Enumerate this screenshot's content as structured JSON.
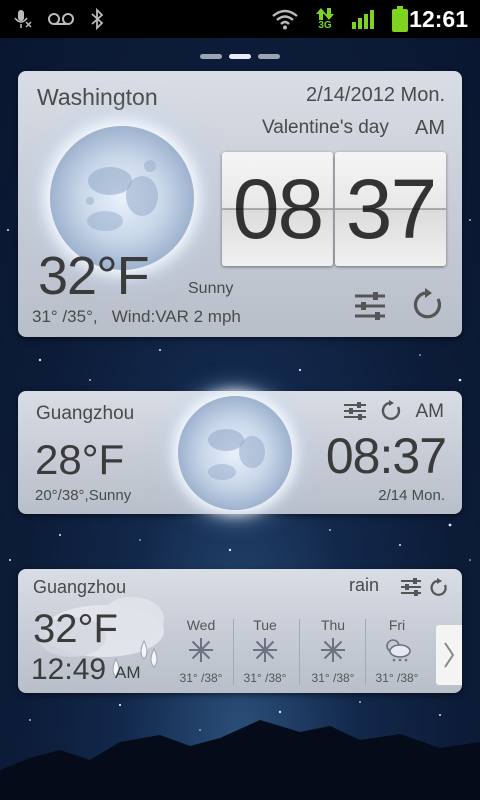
{
  "status_bar": {
    "time": "12:61",
    "network": "3G",
    "icons": [
      "mic-muted-icon",
      "voicemail-icon",
      "bluetooth-icon",
      "wifi-icon",
      "data-arrows-icon",
      "signal-icon",
      "battery-icon"
    ]
  },
  "pager": {
    "pages": 3,
    "active": 2
  },
  "widget_large": {
    "city": "Washington",
    "date": "2/14/2012 Mon.",
    "holiday": "Valentine's day",
    "ampm": "AM",
    "hour": "08",
    "minute": "37",
    "temp": "32°F",
    "condition": "Sunny",
    "range_wind": "31° /35°,   Wind:VAR 2 mph"
  },
  "widget_medium": {
    "city": "Guangzhou",
    "ampm": "AM",
    "temp": "28°F",
    "time": "08:37",
    "range_condition": "20°/38°,Sunny",
    "date": "2/14 Mon."
  },
  "widget_forecast": {
    "city": "Guangzhou",
    "condition": "rain",
    "temp": "32°F",
    "time": "12:49",
    "ampm": "AM",
    "days": [
      {
        "day": "Wed",
        "icon": "snowflake-icon",
        "temp": "31° /38°"
      },
      {
        "day": "Tue",
        "icon": "snowflake-icon",
        "temp": "31° /38°"
      },
      {
        "day": "Thu",
        "icon": "snowflake-icon",
        "temp": "31° /38°"
      },
      {
        "day": "Fri",
        "icon": "partly-cloudy-snow-icon",
        "temp": "31° /38°"
      }
    ]
  },
  "colors": {
    "panel": "#c9ced8",
    "status_green": "#7ed321",
    "sky": "#12284b",
    "text": "#4a4a4a"
  }
}
